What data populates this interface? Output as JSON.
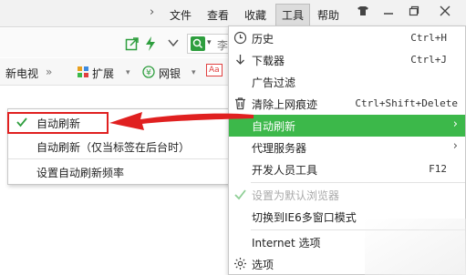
{
  "menubar": {
    "nav_arrow": "›",
    "items": [
      "文件",
      "查看",
      "收藏",
      "工具",
      "帮助"
    ],
    "active_index": 3
  },
  "addressbar": {
    "search_partial": "李"
  },
  "bookmarks": {
    "items": [
      "新电视",
      "»",
      "扩展",
      "网银",
      "Aa"
    ],
    "dropdown_glyph": "▾"
  },
  "left_menu": {
    "items": [
      {
        "label": "自动刷新",
        "checked": true
      },
      {
        "label": "自动刷新（仅当标签在后台时）",
        "checked": false
      },
      {
        "label": "设置自动刷新频率",
        "checked": false
      }
    ]
  },
  "right_menu": {
    "items": [
      {
        "label": "历史",
        "shortcut": "Ctrl+H",
        "icon": "clock-icon"
      },
      {
        "label": "下载器",
        "shortcut": "Ctrl+J",
        "icon": "download-icon"
      },
      {
        "label": "广告过滤",
        "shortcut": "",
        "icon": ""
      },
      {
        "label": "清除上网痕迹",
        "shortcut": "Ctrl+Shift+Delete",
        "icon": "trash-icon"
      },
      {
        "label": "自动刷新",
        "shortcut": "",
        "icon": "",
        "submenu": true,
        "selected": true
      },
      {
        "label": "代理服务器",
        "shortcut": "",
        "icon": "",
        "submenu": true
      },
      {
        "label": "开发人员工具",
        "shortcut": "F12",
        "icon": ""
      },
      {
        "label": "设置为默认浏览器",
        "shortcut": "",
        "icon": "check-icon",
        "disabled": true
      },
      {
        "label": "切换到IE6多窗口模式",
        "shortcut": "",
        "icon": ""
      },
      {
        "label": "Internet 选项",
        "shortcut": "",
        "icon": ""
      },
      {
        "label": "选项",
        "shortcut": "",
        "icon": "gear-icon"
      }
    ],
    "submenu_glyph": "›"
  },
  "colors": {
    "selected_bg": "#3cb84a",
    "highlight_red": "#e02020",
    "check_green": "#2e9e3e"
  }
}
